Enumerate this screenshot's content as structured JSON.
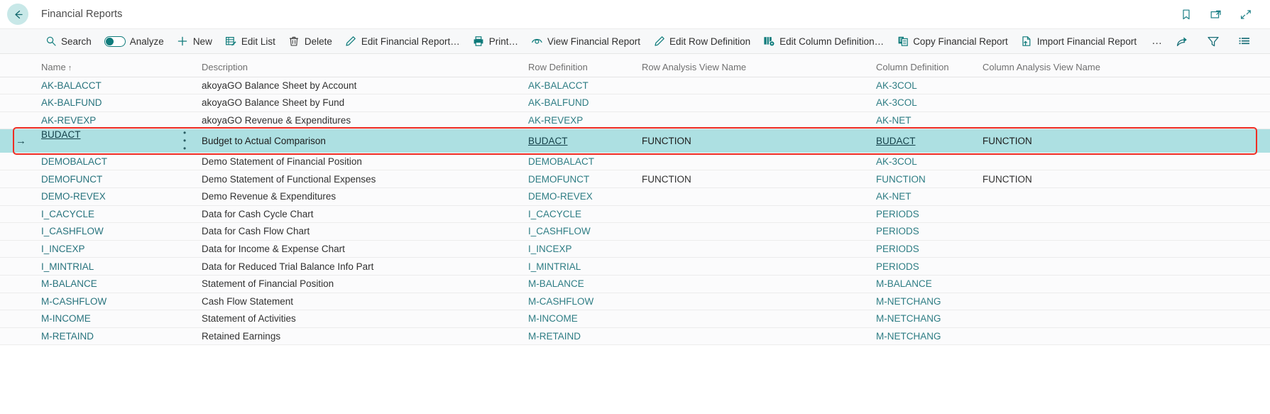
{
  "window": {
    "title": "Financial Reports",
    "back_icon": "arrow-left-icon",
    "top_icons": [
      {
        "name": "bookmark-icon",
        "label": "Bookmark"
      },
      {
        "name": "open-in-new-window-icon",
        "label": "Open in new window"
      },
      {
        "name": "collapse-icon",
        "label": "Minimize"
      }
    ]
  },
  "toolbar": {
    "items": [
      {
        "label": "Search",
        "icon": "search-icon"
      },
      {
        "label": "Analyze",
        "icon": "toggle-switch"
      },
      {
        "label": "New",
        "icon": "plus-icon"
      },
      {
        "label": "Edit List",
        "icon": "edit-list-icon"
      },
      {
        "label": "Delete",
        "icon": "trash-icon"
      },
      {
        "label": "Edit Financial Report…",
        "icon": "pencil-icon"
      },
      {
        "label": "Print…",
        "icon": "printer-icon"
      },
      {
        "label": "View Financial Report",
        "icon": "eye-icon"
      },
      {
        "label": "Edit Row Definition",
        "icon": "pencil-icon"
      },
      {
        "label": "Edit Column Definition…",
        "icon": "column-gear-icon"
      },
      {
        "label": "Copy Financial Report",
        "icon": "copy-icon"
      },
      {
        "label": "Import Financial Report",
        "icon": "import-file-icon"
      }
    ],
    "overflow_label": "…",
    "right_icons": [
      {
        "name": "share-icon",
        "label": "Share"
      },
      {
        "name": "filter-icon",
        "label": "Filter"
      },
      {
        "name": "list-options-icon",
        "label": "Open in Excel / List options"
      }
    ]
  },
  "table": {
    "columns": [
      {
        "key": "name",
        "label": "Name",
        "sort": "ascending",
        "sort_glyph": "↑"
      },
      {
        "key": "description",
        "label": "Description"
      },
      {
        "key": "row_definition",
        "label": "Row Definition"
      },
      {
        "key": "row_analysis_view_name",
        "label": "Row Analysis View Name"
      },
      {
        "key": "column_definition",
        "label": "Column Definition"
      },
      {
        "key": "column_analysis_view_name",
        "label": "Column Analysis View Name"
      }
    ],
    "selected_row_index": 3,
    "selected_row_indicator": "→",
    "row_menu_glyph": "⋮",
    "rows": [
      {
        "name": "AK-BALACCT",
        "description": "akoyaGO Balance Sheet by Account",
        "row_definition": "AK-BALACCT",
        "row_analysis_view_name": "",
        "column_definition": "AK-3COL",
        "column_analysis_view_name": ""
      },
      {
        "name": "AK-BALFUND",
        "description": "akoyaGO Balance Sheet by Fund",
        "row_definition": "AK-BALFUND",
        "row_analysis_view_name": "",
        "column_definition": "AK-3COL",
        "column_analysis_view_name": ""
      },
      {
        "name": "AK-REVEXP",
        "description": "akoyaGO Revenue & Expenditures",
        "row_definition": "AK-REVEXP",
        "row_analysis_view_name": "",
        "column_definition": "AK-NET",
        "column_analysis_view_name": ""
      },
      {
        "name": "BUDACT",
        "description": "Budget to Actual Comparison",
        "row_definition": "BUDACT",
        "row_analysis_view_name": "FUNCTION",
        "column_definition": "BUDACT",
        "column_analysis_view_name": "FUNCTION"
      },
      {
        "name": "DEMOBALACT",
        "description": "Demo Statement of Financial Position",
        "row_definition": "DEMOBALACT",
        "row_analysis_view_name": "",
        "column_definition": "AK-3COL",
        "column_analysis_view_name": ""
      },
      {
        "name": "DEMOFUNCT",
        "description": "Demo Statement of Functional Expenses",
        "row_definition": "DEMOFUNCT",
        "row_analysis_view_name": "FUNCTION",
        "column_definition": "FUNCTION",
        "column_analysis_view_name": "FUNCTION"
      },
      {
        "name": "DEMO-REVEX",
        "description": "Demo Revenue & Expenditures",
        "row_definition": "DEMO-REVEX",
        "row_analysis_view_name": "",
        "column_definition": "AK-NET",
        "column_analysis_view_name": ""
      },
      {
        "name": "I_CACYCLE",
        "description": "Data for Cash Cycle Chart",
        "row_definition": "I_CACYCLE",
        "row_analysis_view_name": "",
        "column_definition": "PERIODS",
        "column_analysis_view_name": ""
      },
      {
        "name": "I_CASHFLOW",
        "description": "Data for Cash Flow Chart",
        "row_definition": "I_CASHFLOW",
        "row_analysis_view_name": "",
        "column_definition": "PERIODS",
        "column_analysis_view_name": ""
      },
      {
        "name": "I_INCEXP",
        "description": "Data for Income & Expense Chart",
        "row_definition": "I_INCEXP",
        "row_analysis_view_name": "",
        "column_definition": "PERIODS",
        "column_analysis_view_name": ""
      },
      {
        "name": "I_MINTRIAL",
        "description": "Data for Reduced Trial Balance Info Part",
        "row_definition": "I_MINTRIAL",
        "row_analysis_view_name": "",
        "column_definition": "PERIODS",
        "column_analysis_view_name": ""
      },
      {
        "name": "M-BALANCE",
        "description": "Statement of Financial Position",
        "row_definition": "M-BALANCE",
        "row_analysis_view_name": "",
        "column_definition": "M-BALANCE",
        "column_analysis_view_name": ""
      },
      {
        "name": "M-CASHFLOW",
        "description": "Cash Flow Statement",
        "row_definition": "M-CASHFLOW",
        "row_analysis_view_name": "",
        "column_definition": "M-NETCHANG",
        "column_analysis_view_name": ""
      },
      {
        "name": "M-INCOME",
        "description": "Statement of Activities",
        "row_definition": "M-INCOME",
        "row_analysis_view_name": "",
        "column_definition": "M-NETCHANG",
        "column_analysis_view_name": ""
      },
      {
        "name": "M-RETAIND",
        "description": "Retained Earnings",
        "row_definition": "M-RETAIND",
        "row_analysis_view_name": "",
        "column_definition": "M-NETCHANG",
        "column_analysis_view_name": ""
      }
    ]
  },
  "colors": {
    "accent_teal": "#0f7b7b",
    "link_teal": "#27737d",
    "selected_row_bg": "#ade0e2",
    "highlight_border": "#ee2d24",
    "grid_bg": "#fbfbfc",
    "back_button_bg": "#c8e8e8"
  }
}
